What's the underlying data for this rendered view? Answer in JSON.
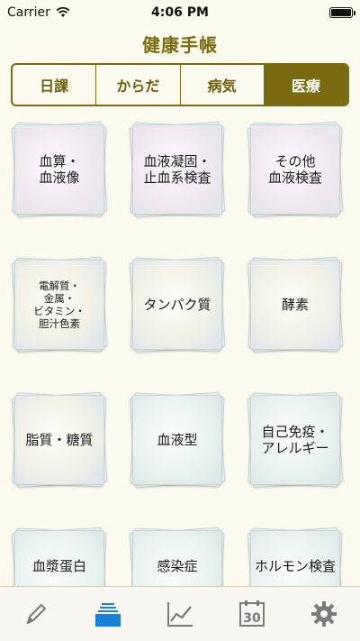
{
  "status": {
    "carrier": "Carrier",
    "time": "4:06 PM"
  },
  "nav": {
    "title": "健康手帳"
  },
  "segments": [
    {
      "label": "日課",
      "active": false
    },
    {
      "label": "からだ",
      "active": false
    },
    {
      "label": "病気",
      "active": false
    },
    {
      "label": "医療",
      "active": true
    }
  ],
  "tiles": [
    {
      "label": "血算・\n血液像"
    },
    {
      "label": "血液凝固・\n止血系検査"
    },
    {
      "label": "その他\n血液検査"
    },
    {
      "label": "電解質・\n金属・\nビタミン・\n胆汁色素"
    },
    {
      "label": "タンパク質"
    },
    {
      "label": "酵素"
    },
    {
      "label": "脂質・糖質"
    },
    {
      "label": "血液型"
    },
    {
      "label": "自己免疫・\nアレルギー"
    },
    {
      "label": "血漿蛋白"
    },
    {
      "label": "感染症"
    },
    {
      "label": "ホルモン検査"
    }
  ],
  "tabs": [
    {
      "icon": "pencil-icon",
      "active": false
    },
    {
      "icon": "stack-icon",
      "active": true
    },
    {
      "icon": "chart-icon",
      "active": false
    },
    {
      "icon": "calendar-icon",
      "active": false,
      "text": "30"
    },
    {
      "icon": "gear-icon",
      "active": false
    }
  ],
  "colors": {
    "accent": "#7a6a10",
    "background": "#fbfaef",
    "tab_active": "#1a7fd6",
    "tab_inactive": "#7a7a7a"
  }
}
